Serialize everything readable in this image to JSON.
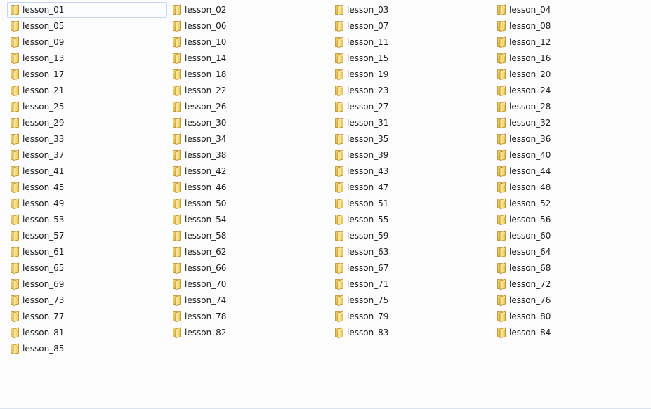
{
  "folder_view": {
    "focused_index": 0,
    "icon": "folder-icon",
    "items": [
      "lesson_01",
      "lesson_02",
      "lesson_03",
      "lesson_04",
      "lesson_05",
      "lesson_06",
      "lesson_07",
      "lesson_08",
      "lesson_09",
      "lesson_10",
      "lesson_11",
      "lesson_12",
      "lesson_13",
      "lesson_14",
      "lesson_15",
      "lesson_16",
      "lesson_17",
      "lesson_18",
      "lesson_19",
      "lesson_20",
      "lesson_21",
      "lesson_22",
      "lesson_23",
      "lesson_24",
      "lesson_25",
      "lesson_26",
      "lesson_27",
      "lesson_28",
      "lesson_29",
      "lesson_30",
      "lesson_31",
      "lesson_32",
      "lesson_33",
      "lesson_34",
      "lesson_35",
      "lesson_36",
      "lesson_37",
      "lesson_38",
      "lesson_39",
      "lesson_40",
      "lesson_41",
      "lesson_42",
      "lesson_43",
      "lesson_44",
      "lesson_45",
      "lesson_46",
      "lesson_47",
      "lesson_48",
      "lesson_49",
      "lesson_50",
      "lesson_51",
      "lesson_52",
      "lesson_53",
      "lesson_54",
      "lesson_55",
      "lesson_56",
      "lesson_57",
      "lesson_58",
      "lesson_59",
      "lesson_60",
      "lesson_61",
      "lesson_62",
      "lesson_63",
      "lesson_64",
      "lesson_65",
      "lesson_66",
      "lesson_67",
      "lesson_68",
      "lesson_69",
      "lesson_70",
      "lesson_71",
      "lesson_72",
      "lesson_73",
      "lesson_74",
      "lesson_75",
      "lesson_76",
      "lesson_77",
      "lesson_78",
      "lesson_79",
      "lesson_80",
      "lesson_81",
      "lesson_82",
      "lesson_83",
      "lesson_84",
      "lesson_85"
    ]
  }
}
